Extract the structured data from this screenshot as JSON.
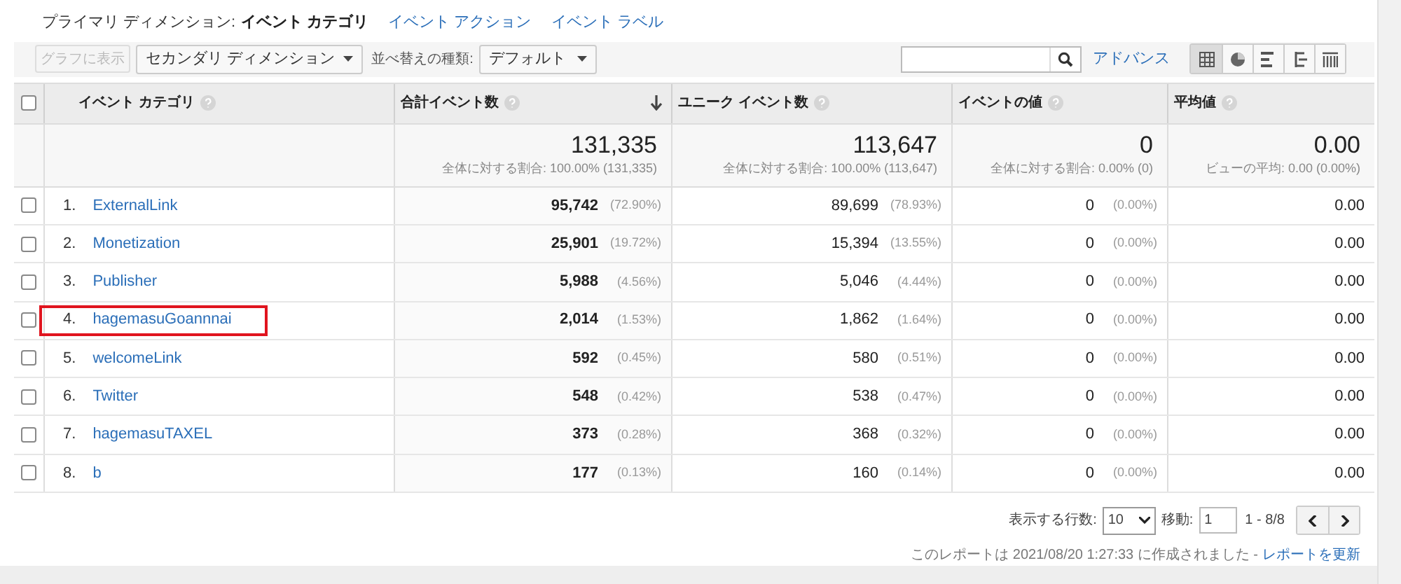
{
  "primary_dimension": {
    "label": "プライマリ ディメンション:",
    "options": [
      {
        "label": "イベント カテゴリ",
        "selected": true
      },
      {
        "label": "イベント アクション",
        "selected": false
      },
      {
        "label": "イベント ラベル",
        "selected": false
      }
    ]
  },
  "toolbar": {
    "plot_button": {
      "label": "グラフに表示",
      "disabled": true
    },
    "secondary_dimension": "セカンダリ ディメンション",
    "sort_label": "並べ替えの種類:",
    "sort_value": "デフォルト",
    "advanced_link": "アドバンス",
    "views": [
      {
        "selected": true
      },
      {
        "selected": false
      },
      {
        "selected": false
      },
      {
        "selected": false
      },
      {
        "selected": false
      }
    ]
  },
  "table": {
    "select_all_checked": false,
    "columns": [
      {
        "label": "イベント カテゴリ",
        "sorted": false
      },
      {
        "label": "合計イベント数",
        "sorted": true
      },
      {
        "label": "ユニーク イベント数",
        "sorted": false
      },
      {
        "label": "イベントの値",
        "sorted": false
      },
      {
        "label": "平均値",
        "sorted": false
      }
    ],
    "totals": [
      {
        "value": "131,335",
        "note": "全体に対する割合: 100.00% (131,335)"
      },
      {
        "value": "113,647",
        "note": "全体に対する割合: 100.00% (113,647)"
      },
      {
        "value": "0",
        "note": "全体に対する割合: 0.00% (0)"
      },
      {
        "value": "0.00",
        "note": "ビューの平均: 0.00 (0.00%)"
      }
    ],
    "rows": [
      {
        "index": "1.",
        "name": "ExternalLink",
        "checked": false,
        "highlighted": false,
        "total": "95,742",
        "total_pct": "(72.90%)",
        "unique": "89,699",
        "unique_pct": "(78.93%)",
        "value": "0",
        "value_pct": "(0.00%)",
        "avg": "0.00"
      },
      {
        "index": "2.",
        "name": "Monetization",
        "checked": false,
        "highlighted": false,
        "total": "25,901",
        "total_pct": "(19.72%)",
        "unique": "15,394",
        "unique_pct": "(13.55%)",
        "value": "0",
        "value_pct": "(0.00%)",
        "avg": "0.00"
      },
      {
        "index": "3.",
        "name": "Publisher",
        "checked": false,
        "highlighted": false,
        "total": "5,988",
        "total_pct": "(4.56%)",
        "unique": "5,046",
        "unique_pct": "(4.44%)",
        "value": "0",
        "value_pct": "(0.00%)",
        "avg": "0.00"
      },
      {
        "index": "4.",
        "name": "hagemasuGoannnai",
        "checked": false,
        "highlighted": true,
        "total": "2,014",
        "total_pct": "(1.53%)",
        "unique": "1,862",
        "unique_pct": "(1.64%)",
        "value": "0",
        "value_pct": "(0.00%)",
        "avg": "0.00"
      },
      {
        "index": "5.",
        "name": "welcomeLink",
        "checked": false,
        "highlighted": false,
        "total": "592",
        "total_pct": "(0.45%)",
        "unique": "580",
        "unique_pct": "(0.51%)",
        "value": "0",
        "value_pct": "(0.00%)",
        "avg": "0.00"
      },
      {
        "index": "6.",
        "name": "Twitter",
        "checked": false,
        "highlighted": false,
        "total": "548",
        "total_pct": "(0.42%)",
        "unique": "538",
        "unique_pct": "(0.47%)",
        "value": "0",
        "value_pct": "(0.00%)",
        "avg": "0.00"
      },
      {
        "index": "7.",
        "name": "hagemasuTAXEL",
        "checked": false,
        "highlighted": false,
        "total": "373",
        "total_pct": "(0.28%)",
        "unique": "368",
        "unique_pct": "(0.32%)",
        "value": "0",
        "value_pct": "(0.00%)",
        "avg": "0.00"
      },
      {
        "index": "8.",
        "name": "b",
        "checked": false,
        "highlighted": false,
        "total": "177",
        "total_pct": "(0.13%)",
        "unique": "160",
        "unique_pct": "(0.14%)",
        "value": "0",
        "value_pct": "(0.00%)",
        "avg": "0.00"
      }
    ]
  },
  "footer": {
    "rows_label": "表示する行数:",
    "rows_value": "10",
    "goto_label": "移動:",
    "goto_value": "1",
    "range": "1 - 8/8",
    "report_text": "このレポートは 2021/08/20 1:27:33 に作成されました -",
    "refresh_link": "レポートを更新"
  }
}
